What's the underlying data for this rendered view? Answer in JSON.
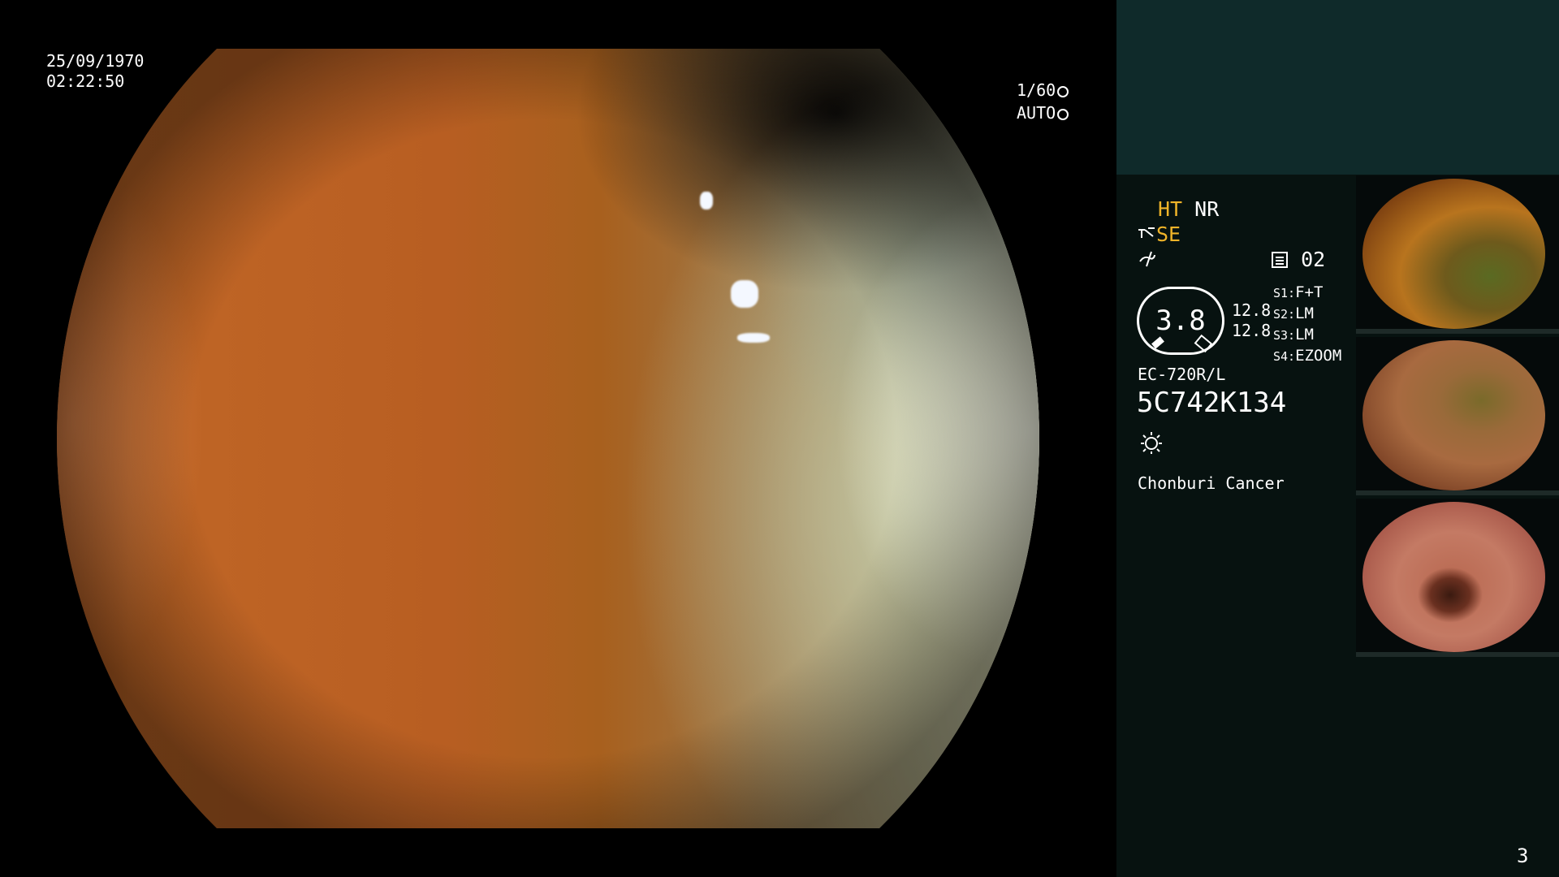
{
  "overlay": {
    "date": "25/09/1970",
    "time": "02:22:50",
    "shutter": "1/60",
    "iris_mode": "AUTO"
  },
  "panel": {
    "ht": "HT",
    "nr": "NR",
    "se": "SE",
    "memory_channel": "02",
    "dial_value": "3.8",
    "dial_upper": "12.8",
    "dial_lower": "12.8",
    "switches": [
      {
        "key": "S1:",
        "value": "F+T"
      },
      {
        "key": "S2:",
        "value": "LM"
      },
      {
        "key": "S3:",
        "value": "LM"
      },
      {
        "key": "S4:",
        "value": "EZOOM"
      }
    ],
    "scope_model": "EC-720R/L",
    "serial": "5C742K134",
    "institution": "Chonburi Cancer",
    "page_number": "3"
  },
  "colors": {
    "panel_top": "#0f2a2a",
    "panel_bottom": "#071210",
    "highlight_text": "#f0b429"
  },
  "icons": [
    "aperture-icon",
    "iris-icon",
    "freeze-icon",
    "enhance-icon",
    "memory-icon",
    "light-source-icon"
  ]
}
